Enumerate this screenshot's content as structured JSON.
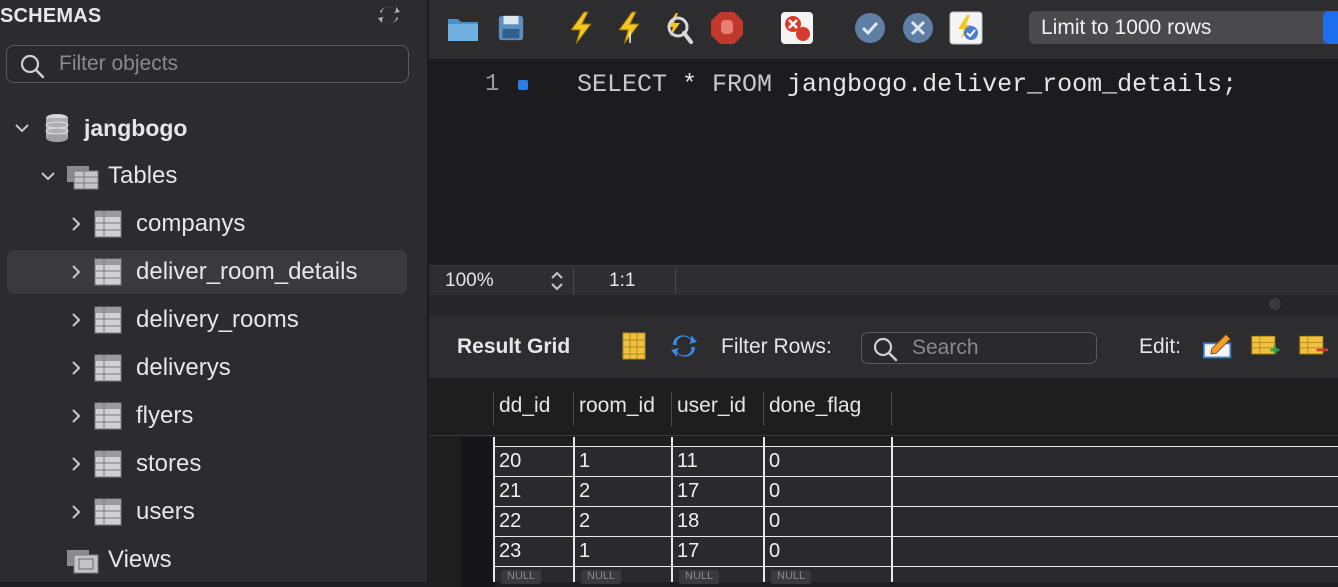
{
  "sidebar": {
    "title": "SCHEMAS",
    "filter_placeholder": "Filter objects",
    "schema_name": "jangbogo",
    "tables_label": "Tables",
    "views_label": "Views",
    "tables": [
      "companys",
      "deliver_room_details",
      "delivery_rooms",
      "deliverys",
      "flyers",
      "stores",
      "users"
    ],
    "selected_table": "deliver_room_details"
  },
  "toolbar": {
    "limit_label": "Limit to 1000 rows",
    "icons": [
      "open-folder-icon",
      "save-icon",
      "execute-icon",
      "execute-current-icon",
      "explain-icon",
      "stop-icon",
      "toggle-error-icon",
      "commit-icon",
      "rollback-icon",
      "autocommit-icon"
    ]
  },
  "editor": {
    "line_number": "1",
    "kw_select": "SELECT",
    "star": " * ",
    "kw_from": "FROM",
    "target": " jangbogo.deliver_room_details;"
  },
  "status": {
    "zoom": "100%",
    "position": "1:1"
  },
  "result": {
    "title": "Result Grid",
    "filter_label": "Filter Rows:",
    "search_placeholder": "Search",
    "edit_label": "Edit:",
    "columns": [
      "dd_id",
      "room_id",
      "user_id",
      "done_flag"
    ],
    "rows": [
      [
        "20",
        "1",
        "11",
        "0"
      ],
      [
        "21",
        "2",
        "17",
        "0"
      ],
      [
        "22",
        "2",
        "18",
        "0"
      ],
      [
        "23",
        "1",
        "17",
        "0"
      ]
    ],
    "null_label": "NULL"
  }
}
